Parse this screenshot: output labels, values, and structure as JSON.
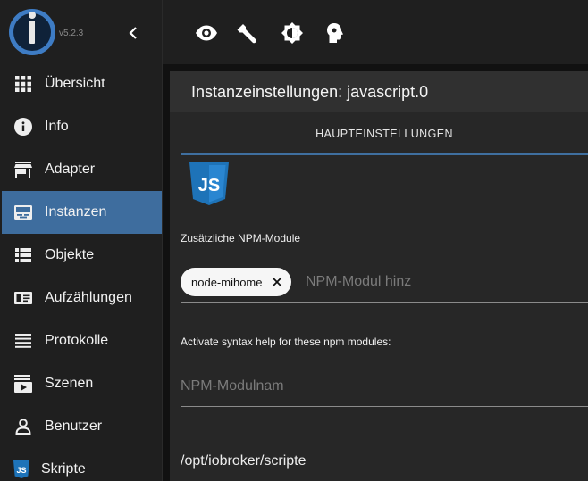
{
  "sidebar": {
    "version": "v5.2.3",
    "items": [
      {
        "label": "Übersicht",
        "icon": "grid-icon"
      },
      {
        "label": "Info",
        "icon": "info-icon"
      },
      {
        "label": "Adapter",
        "icon": "store-icon"
      },
      {
        "label": "Instanzen",
        "icon": "instances-icon",
        "active": true
      },
      {
        "label": "Objekte",
        "icon": "list-icon"
      },
      {
        "label": "Aufzählungen",
        "icon": "enum-icon"
      },
      {
        "label": "Protokolle",
        "icon": "log-icon"
      },
      {
        "label": "Szenen",
        "icon": "scenes-icon"
      },
      {
        "label": "Benutzer",
        "icon": "user-icon"
      },
      {
        "label": "Skripte",
        "icon": "javascript-icon"
      }
    ]
  },
  "toolbar": {
    "icons": [
      "eye-icon",
      "wrench-icon",
      "brightness-icon",
      "expert-mode-icon"
    ]
  },
  "panel": {
    "title": "Instanzeinstellungen: javascript.0",
    "tab_label": "HAUPTEINSTELLUNGEN",
    "js_logo_text": "JS",
    "npm_label": "Zusätzliche NPM-Module",
    "chip_value": "node-mihome",
    "npm_placeholder": "NPM-Modul hinz",
    "syntax_label": "Activate syntax help for these npm modules:",
    "syntax_placeholder": "NPM-Modulnam",
    "path_value": "/opt/iobroker/scripte"
  },
  "colors": {
    "accent": "#3e6d9e",
    "logo_blue": "#3e7cc4",
    "js_blue": "#1e73b8"
  }
}
